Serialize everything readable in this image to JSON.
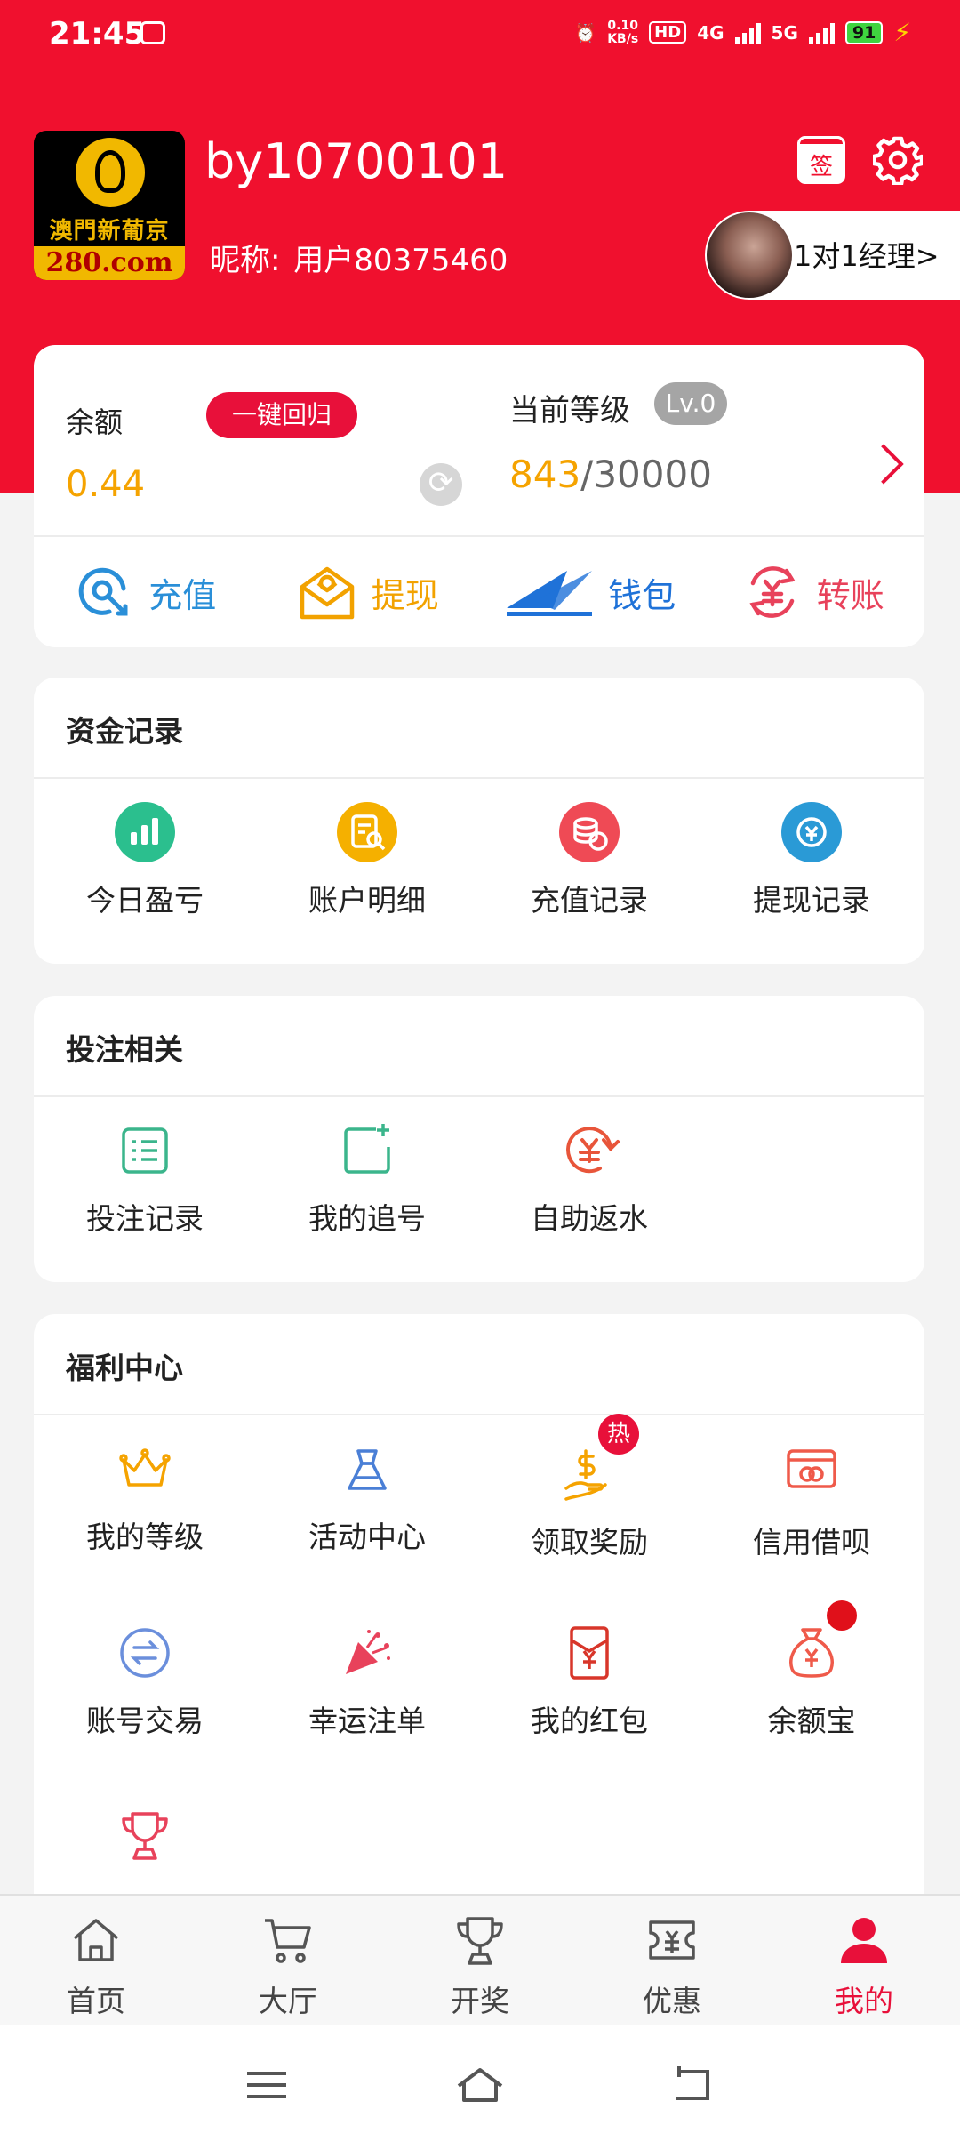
{
  "status_bar": {
    "time": "21:45",
    "net_speed": "0.10",
    "net_unit": "KB/s",
    "hd": "HD",
    "net_4g": "4G",
    "net_5g": "5G",
    "battery": "91"
  },
  "profile": {
    "logo_cn": "澳門新葡京",
    "logo_en": "280.com",
    "username": "by10700101",
    "nickname_label": "昵称:",
    "nickname": "用户80375460",
    "sign_label": "签",
    "manager_label": "1对1经理>"
  },
  "account": {
    "balance_label": "余额",
    "return_button": "一键回归",
    "balance_value": "0.44",
    "level_label": "当前等级",
    "level_badge": "Lv.0",
    "level_current": "843",
    "level_total": "/30000"
  },
  "actions": [
    {
      "label": "充值",
      "color": "#2a8fd8",
      "icon": "deposit-icon"
    },
    {
      "label": "提现",
      "color": "#f2a200",
      "icon": "withdraw-icon"
    },
    {
      "label": "钱包",
      "color": "#1f72d8",
      "icon": "wallet-icon"
    },
    {
      "label": "转账",
      "color": "#e8425b",
      "icon": "transfer-icon"
    }
  ],
  "fund_records": {
    "title": "资金记录",
    "items": [
      {
        "label": "今日盈亏",
        "color": "#2bbf8e",
        "icon": "chart-icon"
      },
      {
        "label": "账户明细",
        "color": "#f5b000",
        "icon": "detail-icon"
      },
      {
        "label": "充值记录",
        "color": "#ef4a55",
        "icon": "coins-icon"
      },
      {
        "label": "提现记录",
        "color": "#2a9ad6",
        "icon": "exchange-icon"
      }
    ]
  },
  "betting": {
    "title": "投注相关",
    "items": [
      {
        "label": "投注记录",
        "icon": "list-icon"
      },
      {
        "label": "我的追号",
        "icon": "add-note-icon"
      },
      {
        "label": "自助返水",
        "icon": "rebate-icon"
      }
    ]
  },
  "welfare": {
    "title": "福利中心",
    "hot_badge": "热",
    "items": [
      {
        "label": "我的等级",
        "icon": "crown-icon"
      },
      {
        "label": "活动中心",
        "icon": "activity-icon"
      },
      {
        "label": "领取奖励",
        "icon": "reward-icon"
      },
      {
        "label": "信用借呗",
        "icon": "credit-icon"
      },
      {
        "label": "账号交易",
        "icon": "account-trade-icon"
      },
      {
        "label": "幸运注单",
        "icon": "party-icon"
      },
      {
        "label": "我的红包",
        "icon": "red-packet-icon"
      },
      {
        "label": "余额宝",
        "icon": "money-bag-icon"
      }
    ]
  },
  "tabbar": [
    {
      "label": "首页",
      "icon": "home-icon"
    },
    {
      "label": "大厅",
      "icon": "cart-icon"
    },
    {
      "label": "开奖",
      "icon": "trophy-icon"
    },
    {
      "label": "优惠",
      "icon": "coupon-icon"
    },
    {
      "label": "我的",
      "icon": "user-icon",
      "active": true
    }
  ],
  "colors": {
    "brand_red": "#f0102e",
    "accent_orange": "#f5a300"
  }
}
